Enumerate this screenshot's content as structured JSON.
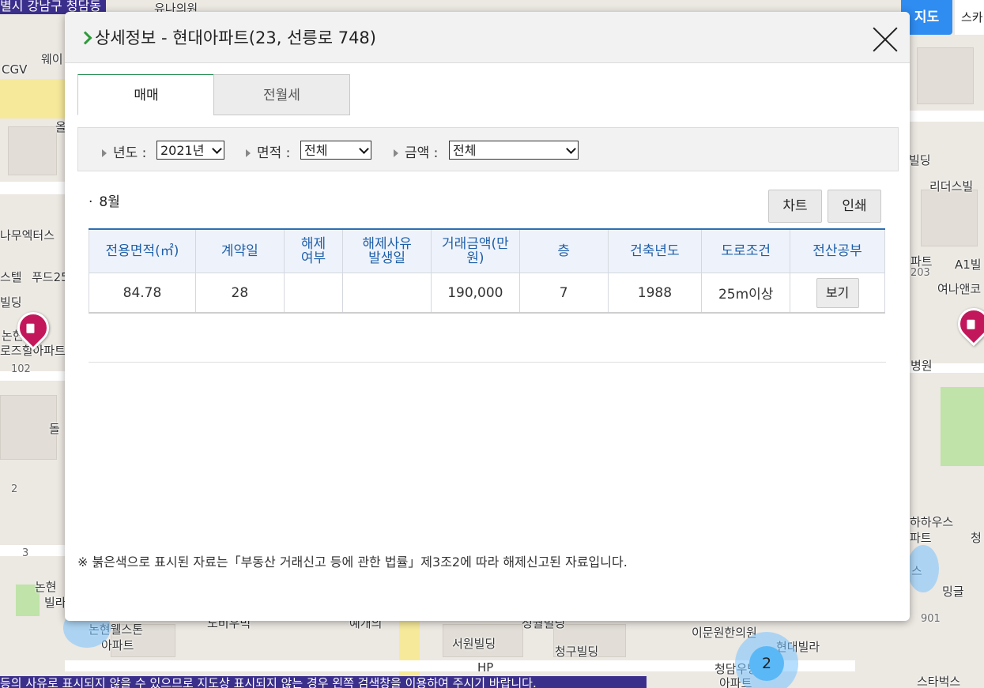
{
  "map": {
    "top_region_text": "별시 강남구 청담동",
    "bottom_notice": "등의 사유로 표시되지 않을 수 있으므로 지도상 표시되지 않는 경우 왼쪽 검색창을 이용하여 주시기 바랍니다.",
    "map_button": "지도",
    "map_button2": "스카",
    "cluster_count": "2",
    "labels": [
      "유나의원",
      "웨이",
      "CGV",
      "올",
      "나무엑터스",
      "스텔",
      "푸드25",
      "빌딩",
      "논현",
      "로즈힐아파트",
      "102",
      "돌",
      "2",
      "3",
      "논현",
      "빌라",
      "논현웰스톤",
      "아파트",
      "도비우빅",
      "예개의",
      "서원빌딩",
      "HP",
      "청구빌딩",
      "성월빌딩",
      "이문원한의원",
      "현대빌라",
      "청담우방",
      "아파트",
      "스타벅스",
      "빌딩",
      "리더스빌",
      "파트",
      "203",
      "A1빌",
      "여나앤코",
      "병원",
      "하하우스",
      "파트",
      "청",
      "스",
      "밍글",
      "901"
    ]
  },
  "modal": {
    "title": "상세정보 - 현대아파트(23, 선릉로 748)",
    "tabs": [
      {
        "label": "매매"
      },
      {
        "label": "전월세"
      }
    ],
    "filters": {
      "year_label": "년도 :",
      "year_value": "2021년",
      "area_label": "면적 :",
      "area_value": "전체",
      "price_label": "금액 :",
      "price_value": "전체"
    },
    "month": "8월",
    "buttons": {
      "chart": "차트",
      "print": "인쇄"
    },
    "table": {
      "headers": [
        "전용면적(㎡)",
        "계약일",
        "해제\n여부",
        "해제사유\n발생일",
        "거래금액(만\n원)",
        "층",
        "건축년도",
        "도로조건",
        "전산공부"
      ],
      "rows": [
        {
          "area": "84.78",
          "day": "28",
          "cancel": "",
          "cancel_date": "",
          "price": "190,000",
          "floor": "7",
          "built": "1988",
          "road": "25m이상",
          "doc": "보기"
        }
      ]
    },
    "footnote": "※ 붉은색으로 표시된 자료는「부동산 거래신고 등에 관한 법률」제3조2에 따라 해제신고된 자료입니다."
  }
}
